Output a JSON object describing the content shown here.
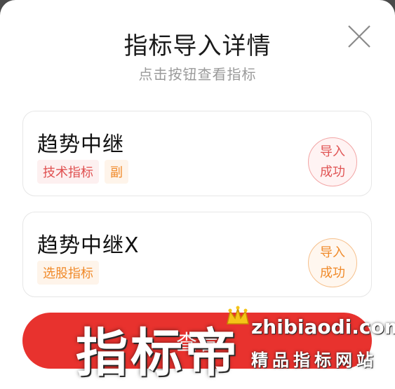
{
  "modal": {
    "title": "指标导入详情",
    "subtitle": "点击按钮查看指标"
  },
  "indicators": [
    {
      "name": "趋势中继",
      "tags": [
        "技术指标",
        "副"
      ],
      "status_line1": "导入",
      "status_line2": "成功",
      "status_color": "#e05555"
    },
    {
      "name": "趋势中继X",
      "tags": [
        "选股指标"
      ],
      "status_line1": "导入",
      "status_line2": "成功",
      "status_color": "#f08a2a"
    }
  ],
  "bottom_button": {
    "label": "查看"
  },
  "watermark": {
    "brand": "指标帝",
    "url": "zhibiaodi.com",
    "tagline": "精品指标网站"
  },
  "colors": {
    "primary_red": "#e8322e",
    "tag_red": "#e05050",
    "tag_orange": "#f08a2a"
  },
  "icons": {
    "close": "close-icon",
    "crown": "crown-icon"
  }
}
